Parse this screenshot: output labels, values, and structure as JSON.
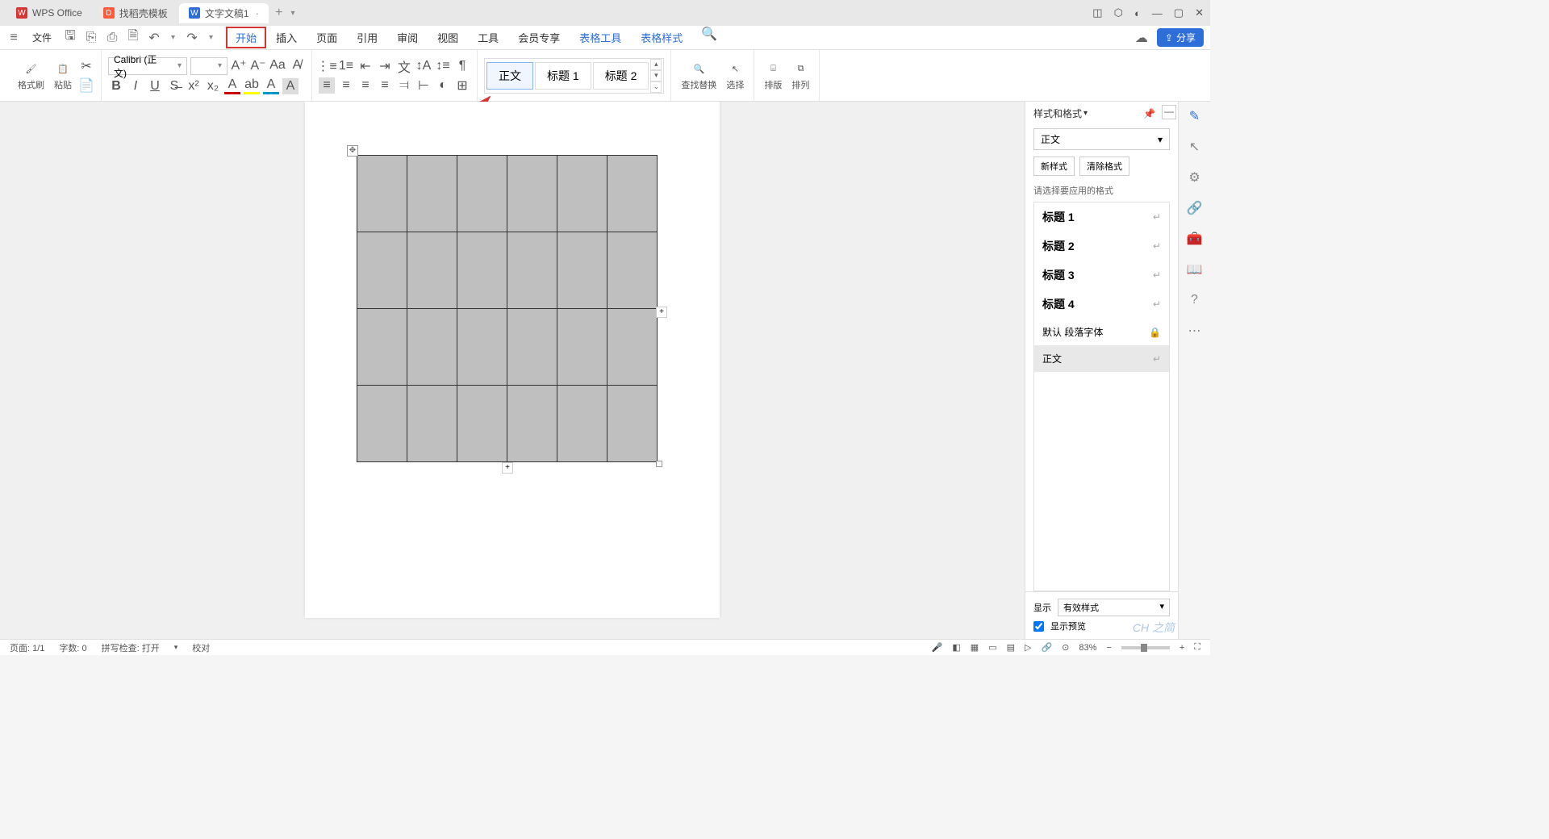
{
  "titlebar": {
    "tabs": [
      {
        "label": "WPS Office",
        "icon_bg": "#d43535",
        "icon_text": "W"
      },
      {
        "label": "找稻壳模板",
        "icon_bg": "#ff5a3c",
        "icon_text": "D"
      },
      {
        "label": "文字文稿1",
        "icon_bg": "#2e6ed8",
        "icon_text": "W",
        "active": true
      }
    ]
  },
  "menubar": {
    "file": "文件",
    "tabs": [
      "开始",
      "插入",
      "页面",
      "引用",
      "审阅",
      "视图",
      "工具",
      "会员专享",
      "表格工具",
      "表格样式"
    ],
    "share": "分享"
  },
  "ribbon": {
    "format_brush": "格式刷",
    "paste": "粘贴",
    "font_name": "Calibri (正文)",
    "font_size": "",
    "style_gallery": [
      "正文",
      "标题 1",
      "标题 2"
    ],
    "find_replace": "查找替换",
    "select": "选择",
    "layout": "排版",
    "arrange": "排列"
  },
  "sidepanel": {
    "title": "样式和格式",
    "current_style": "正文",
    "new_style": "新样式",
    "clear_format": "清除格式",
    "choose_label": "请选择要应用的格式",
    "items": [
      "标题 1",
      "标题 2",
      "标题 3",
      "标题 4"
    ],
    "default_font": "默认 段落字体",
    "body_text": "正文",
    "display_label": "显示",
    "display_value": "有效样式",
    "preview_label": "显示预览"
  },
  "statusbar": {
    "page": "页面: 1/1",
    "words": "字数: 0",
    "spell": "拼写检查: 打开",
    "proof": "校对",
    "zoom": "83%"
  },
  "watermark": "CH 之简"
}
